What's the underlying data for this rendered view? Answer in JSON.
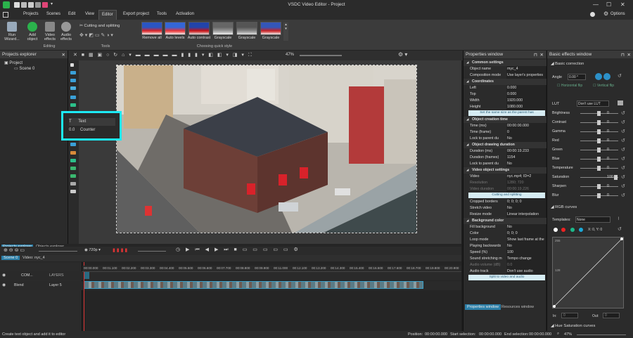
{
  "title": "VSDC Video Editor - Project",
  "window_controls": [
    "minimize",
    "maximize",
    "close"
  ],
  "menu": {
    "items": [
      "Projects",
      "Scenes",
      "Edit",
      "View",
      "Editor",
      "Export project",
      "Tools",
      "Activation"
    ],
    "active": "Editor",
    "options": "Options"
  },
  "ribbon": {
    "run_wizard": "Run Wizard...",
    "editing_buttons": [
      "Add object",
      "Video effects",
      "Audio effects"
    ],
    "editing_label": "Editing",
    "cutting": "Cutting and splitting",
    "tools_label": "Tools",
    "quick_styles": [
      "Remove all",
      "Auto levels",
      "Auto contrast",
      "Grayscale",
      "Grayscale",
      "Grayscale"
    ],
    "quick_style_label": "Choosing quick style"
  },
  "toolbar": {
    "zoom": "47%"
  },
  "projects_explorer": {
    "title": "Projects explorer",
    "tree": [
      "Project",
      "Scene 0"
    ],
    "tabs": [
      "Projects explorer",
      "Objects explorer"
    ]
  },
  "popup": {
    "items": [
      {
        "icon": "T",
        "label": "Text"
      },
      {
        "icon": "0.0",
        "label": "Counter"
      }
    ]
  },
  "properties": {
    "title": "Properties window",
    "rows": [
      {
        "type": "sec",
        "k": "Common settings"
      },
      {
        "k": "Object name",
        "v": "myc_4"
      },
      {
        "k": "Composition mode",
        "v": "Use layer's properties"
      },
      {
        "type": "sec",
        "k": "Coordinates"
      },
      {
        "k": "Left",
        "v": "0.000"
      },
      {
        "k": "Top",
        "v": "0.000"
      },
      {
        "k": "Width",
        "v": "1920.000"
      },
      {
        "k": "Height",
        "v": "1080.000"
      },
      {
        "type": "btn",
        "k": "Set the same size as the parent has"
      },
      {
        "type": "sec",
        "k": "Object creation time"
      },
      {
        "k": "Time (ms)",
        "v": "00:00:00.000"
      },
      {
        "k": "Time (frame)",
        "v": "0"
      },
      {
        "k": "Lock to parent du",
        "v": "No"
      },
      {
        "type": "sec",
        "k": "Object drawing duration"
      },
      {
        "k": "Duration (ms)",
        "v": "00:00:19.233"
      },
      {
        "k": "Duration (frames)",
        "v": "1154"
      },
      {
        "k": "Lock to parent du",
        "v": "No"
      },
      {
        "type": "sec",
        "k": "Video object settings"
      },
      {
        "k": "Video",
        "v": "nyc.mp4; ID=2"
      },
      {
        "type": "dim",
        "k": "Resolution",
        "v": "1280; 720"
      },
      {
        "type": "dim",
        "k": "Video duration",
        "v": "00:00:19.226"
      },
      {
        "type": "btn",
        "k": "Cutting and splitting"
      },
      {
        "k": "Cropped borders",
        "v": "0; 0; 0; 0"
      },
      {
        "k": "Stretch video",
        "v": "No"
      },
      {
        "k": "Resize mode",
        "v": "Linear interpolation"
      },
      {
        "type": "sec",
        "k": "Background color"
      },
      {
        "k": "Fill background",
        "v": "No"
      },
      {
        "k": "Color",
        "v": "0; 0; 0"
      },
      {
        "k": "Loop mode",
        "v": "Show last frame at the"
      },
      {
        "k": "Playing backwards",
        "v": "No"
      },
      {
        "k": "Speed (%)",
        "v": "100"
      },
      {
        "k": "Sound stretching m",
        "v": "Tempo change"
      },
      {
        "type": "dim",
        "k": "Audio volume (dB)",
        "v": "0.0"
      },
      {
        "k": "Audio track",
        "v": "Don't use audio"
      },
      {
        "type": "btn",
        "k": "Split to video and audio"
      }
    ],
    "tabs": [
      "Properties window",
      "Resources window"
    ]
  },
  "basic_effects": {
    "title": "Basic effects window",
    "basic_correction": "Basic correction",
    "angle_label": "Angle",
    "angle_value": "0.00 °",
    "hflip": "Horizontal flip",
    "vflip": "Vertical flip",
    "lut_label": "LUT",
    "lut_value": "Don't use LUT",
    "sliders": [
      {
        "k": "Brightness",
        "v": "0",
        "pos": 0.5
      },
      {
        "k": "Contrast",
        "v": "0",
        "pos": 0.5
      },
      {
        "k": "Gamma",
        "v": "0",
        "pos": 0.5
      },
      {
        "k": "Red",
        "v": "0",
        "pos": 0.5
      },
      {
        "k": "Green",
        "v": "0",
        "pos": 0.5
      },
      {
        "k": "Blue",
        "v": "0",
        "pos": 0.5
      },
      {
        "k": "Temperature",
        "v": "0",
        "pos": 0.5
      },
      {
        "k": "Saturation",
        "v": "100",
        "pos": 1.0
      },
      {
        "k": "Sharpen",
        "v": "0",
        "pos": 0.5
      },
      {
        "k": "Blur",
        "v": "0",
        "pos": 0.5
      }
    ],
    "rgb_curves": "RGB curves",
    "templates_label": "Templates:",
    "templates_value": "None",
    "curve_xy": "X: 0, Y: 0",
    "curve_axis": [
      "255",
      "128"
    ],
    "in_label": "In:",
    "in_value": "0",
    "out_label": "Out:",
    "out_value": "0",
    "hue_sat": "Hue Saturation curves"
  },
  "timeline": {
    "resolution": "720p",
    "breadcrumb": [
      "Scene 0",
      "Video: nyc_4"
    ],
    "ruler": [
      "00:00.000",
      "00:01.100",
      "00:02.200",
      "00:03.300",
      "00:04.400",
      "00:05.500",
      "00:06.600",
      "00:07.700",
      "00:08.800",
      "00:09.900",
      "00:11.000",
      "00:12.100",
      "00:13.200",
      "00:14.300",
      "00:15.400",
      "00:16.500",
      "00:17.600",
      "00:18.700",
      "00:19.800",
      "00:20.900"
    ],
    "tracks": [
      {
        "label": "COM...",
        "layer": "LAYERS"
      },
      {
        "label": "Blend",
        "layer": "Layer 5"
      }
    ]
  },
  "status": {
    "message": "Create text object and add it to editor",
    "position_label": "Position:",
    "position": "00:00:00.000",
    "start_label": "Start selection:",
    "start": "00:00:00.000",
    "end_label": "End selection:",
    "end": "00:00:00.000",
    "zoom": "47%"
  },
  "colors": {
    "accent": "#1de9f3",
    "tab_active": "#2c7fa8",
    "clip": "#3aa0c8"
  }
}
